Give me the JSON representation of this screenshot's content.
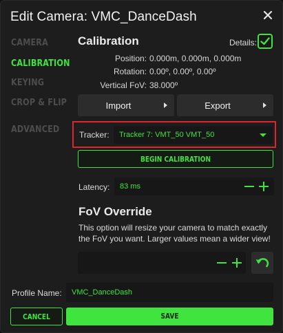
{
  "colors": {
    "accent": "#3fe43f",
    "highlight_border": "#e0252f",
    "panel": "#1d1d1d",
    "field": "#171717",
    "button": "#2c2c2c"
  },
  "dialog": {
    "title": "Edit Camera: VMC_DanceDash",
    "close_icon": "close-icon"
  },
  "nav": {
    "items": [
      {
        "label": "CAMERA",
        "active": false
      },
      {
        "label": "CALIBRATION",
        "active": true
      },
      {
        "label": "KEYING",
        "active": false
      },
      {
        "label": "CROP & FLIP",
        "active": false
      },
      {
        "label": "ADVANCED",
        "active": false
      }
    ]
  },
  "calibration": {
    "title": "Calibration",
    "details_label": "Details:",
    "details_checked": true,
    "position_label": "Position:",
    "position_value": "0.000m, 0.000m, 0.000m",
    "rotation_label": "Rotation:",
    "rotation_value": "0.00º, 0.00º, 0.00º",
    "fov_label": "Vertical FoV:",
    "fov_value": "38.000º",
    "import_label": "Import",
    "export_label": "Export",
    "tracker_label": "Tracker:",
    "tracker_value": "Tracker 7: VMT_50 VMT_50",
    "begin_label": "BEGIN CALIBRATION",
    "latency_label": "Latency:",
    "latency_value": "83 ms"
  },
  "fov_override": {
    "title": "FoV Override",
    "description": "This option will resize your camera to match exactly the FoV you want. Larger values mean a wider view!",
    "value": ""
  },
  "footer": {
    "profile_label": "Profile Name:",
    "profile_value": "VMC_DanceDash",
    "cancel_label": "CANCEL",
    "save_label": "SAVE"
  }
}
